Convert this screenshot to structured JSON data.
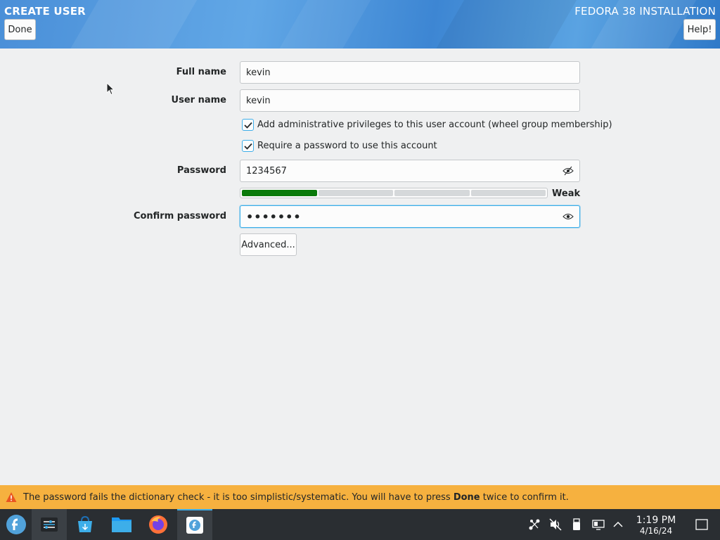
{
  "header": {
    "title": "CREATE USER",
    "product": "FEDORA 38 INSTALLATION",
    "done_label": "Done",
    "help_label": "Help!"
  },
  "form": {
    "full_name_label": "Full name",
    "full_name_value": "kevin",
    "user_name_label": "User name",
    "user_name_value": "kevin",
    "admin_checkbox_label": "Add administrative privileges to this user account (wheel group membership)",
    "admin_checked": true,
    "require_password_label": "Require a password to use this account",
    "require_password_checked": true,
    "password_label": "Password",
    "password_value": "1234567",
    "strength_label": "Weak",
    "strength_level": 0.25,
    "confirm_label": "Confirm password",
    "confirm_value": "•••••••",
    "advanced_label": "Advanced..."
  },
  "warning": {
    "text_before": "The password fails the dictionary check - it is too simplistic/systematic. You will have to press ",
    "text_bold": "Done",
    "text_after": " twice to confirm it."
  },
  "taskbar": {
    "apps": [
      "fedora-launcher-icon",
      "settings-icon",
      "software-store-icon",
      "file-manager-icon",
      "firefox-icon",
      "anaconda-installer-icon"
    ],
    "tray": [
      "network-icon",
      "volume-muted-icon",
      "usb-icon",
      "display-icon",
      "tray-expand-icon"
    ],
    "time": "1:19 PM",
    "date": "4/16/24"
  },
  "colors": {
    "header_blue": "#4a8fd8",
    "warning_orange": "#f6b13f",
    "strength_green": "#0a7a0a",
    "focus_blue": "#3daee9",
    "taskbar": "#2a2e32"
  }
}
